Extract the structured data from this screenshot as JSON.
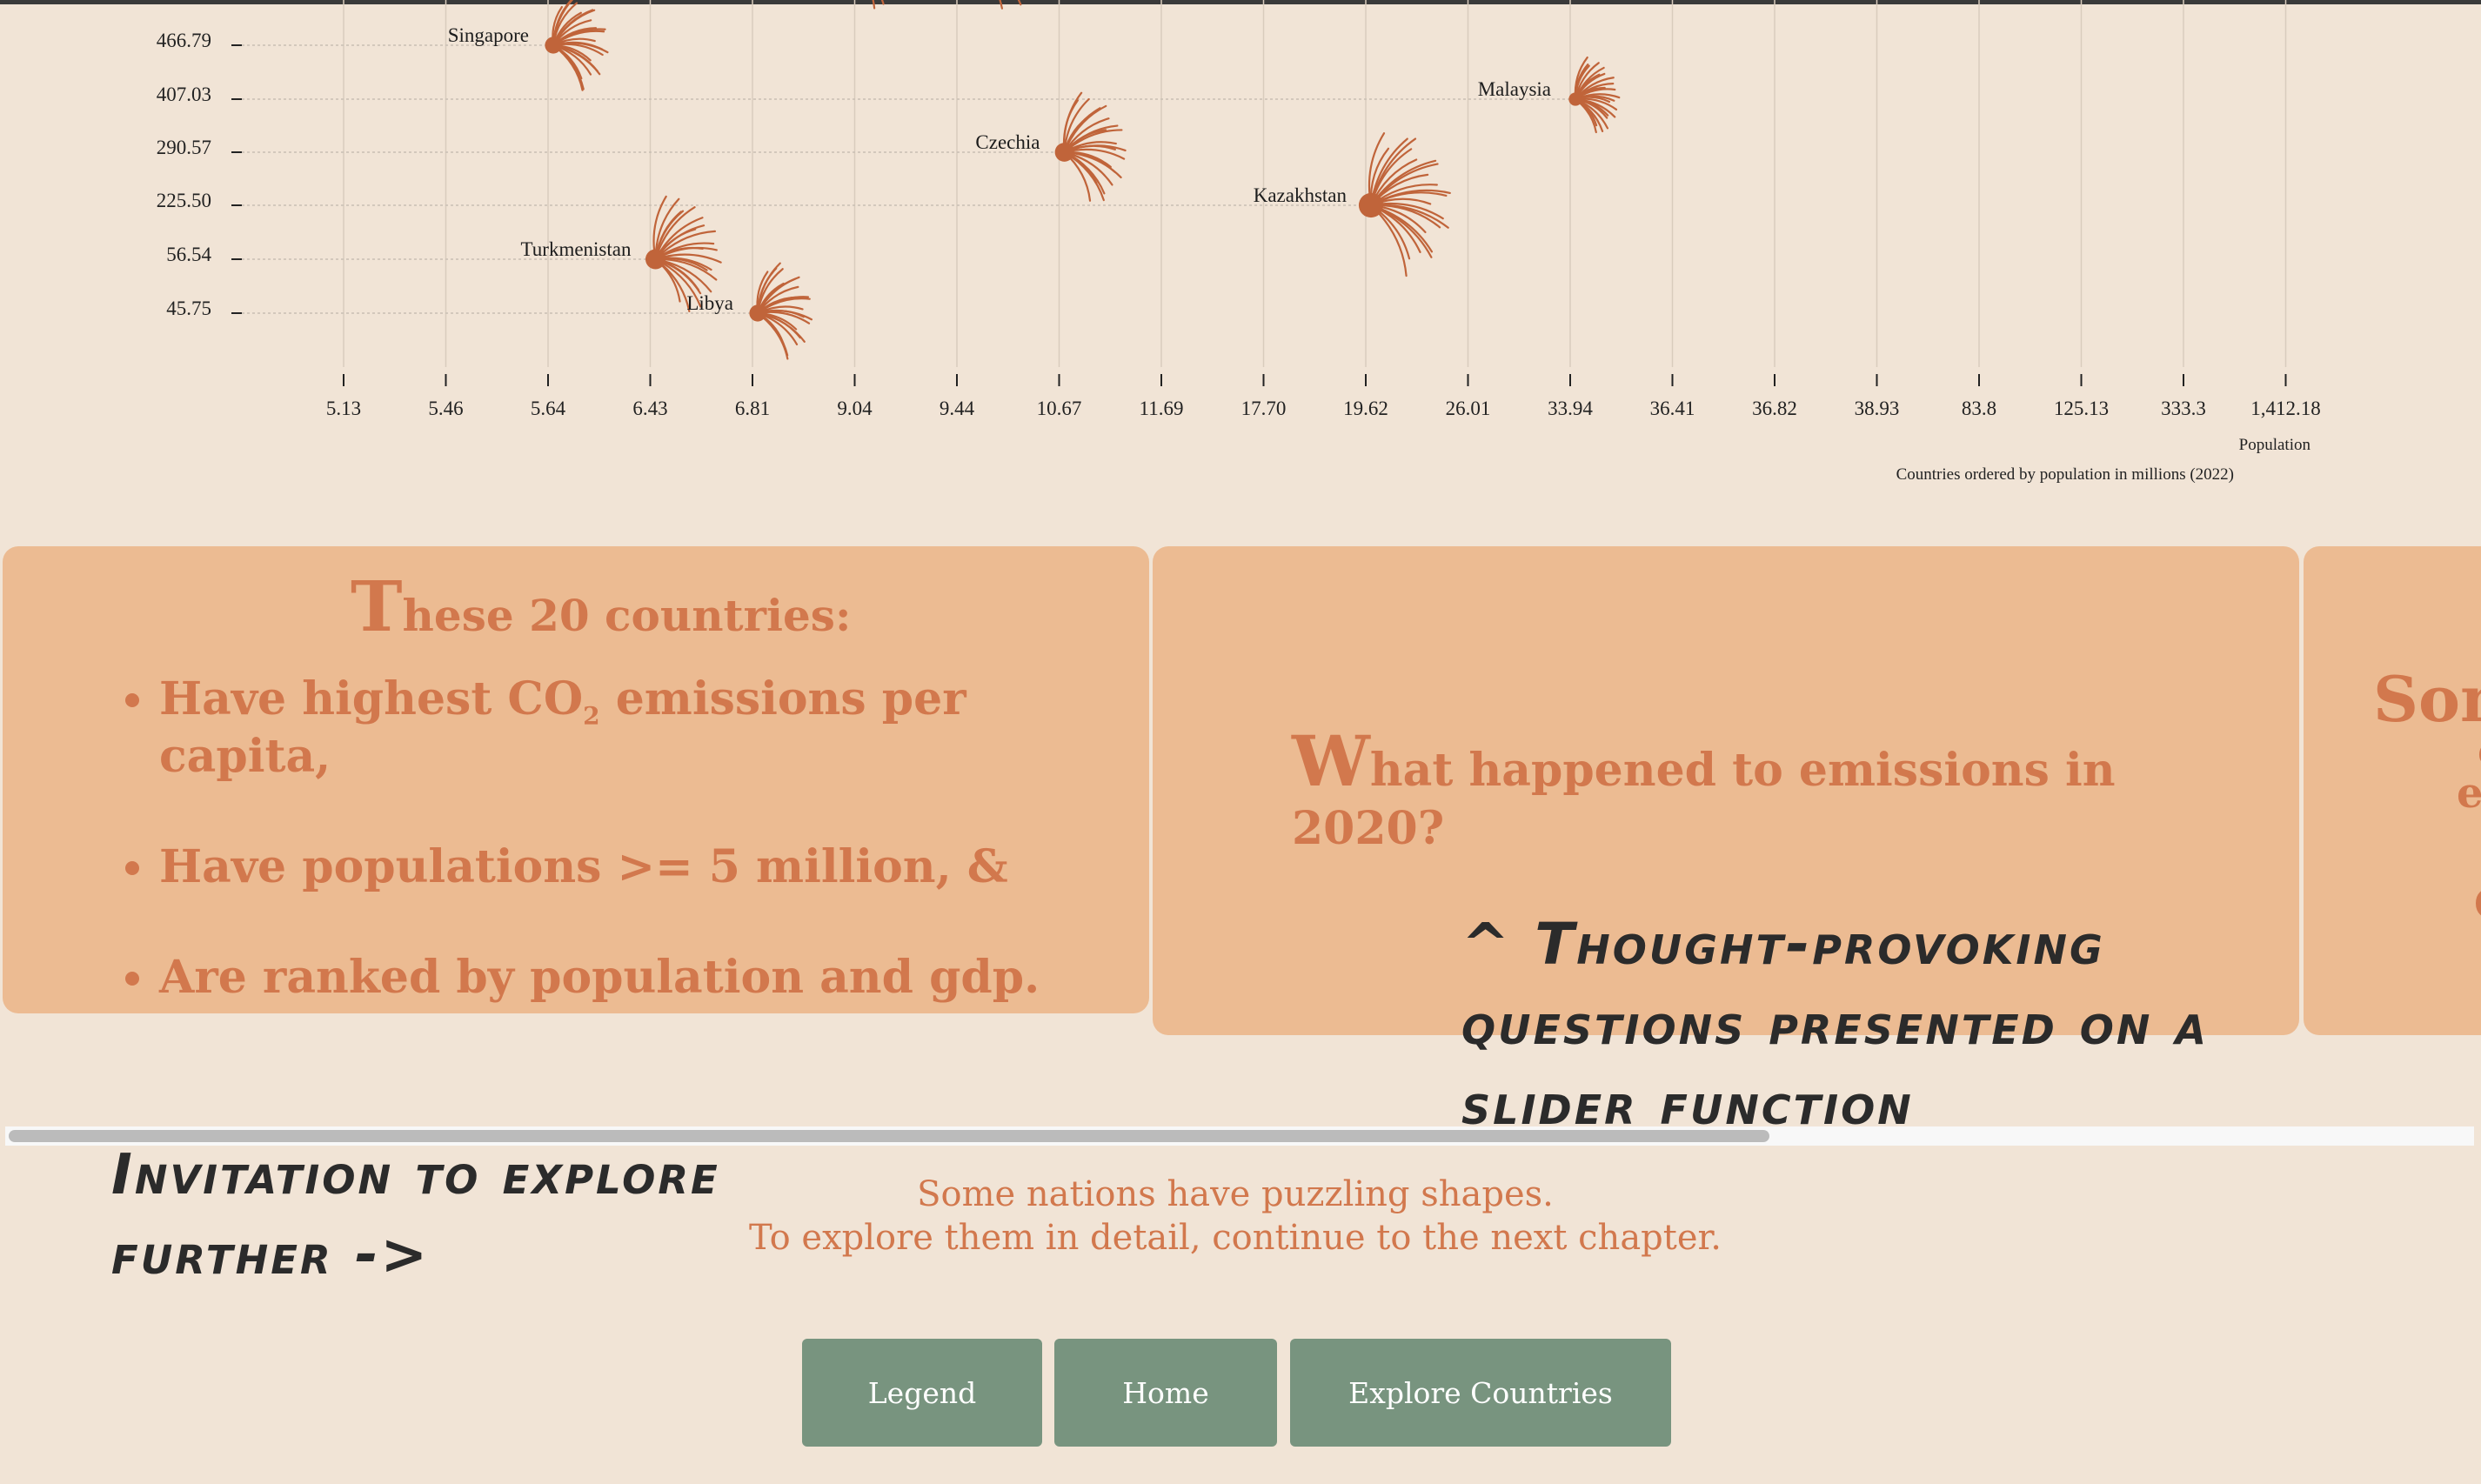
{
  "chart_data": {
    "type": "scatter",
    "x_categories": [
      "5.13",
      "5.46",
      "5.64",
      "6.43",
      "6.81",
      "9.04",
      "9.44",
      "10.67",
      "11.69",
      "17.70",
      "19.62",
      "26.01",
      "33.94",
      "36.41",
      "36.82",
      "38.93",
      "83.8",
      "125.13",
      "333.3",
      "1,412.18"
    ],
    "y_ticks": [
      "466.79",
      "407.03",
      "290.57",
      "225.50",
      "56.54",
      "45.75"
    ],
    "points": [
      {
        "label": "Singapore",
        "x": "5.64",
        "y": "466.79"
      },
      {
        "label": "Malaysia",
        "x": "33.94",
        "y": "407.03"
      },
      {
        "label": "Czechia",
        "x": "10.67",
        "y": "290.57"
      },
      {
        "label": "Kazakhstan",
        "x": "19.62",
        "y": "225.50"
      },
      {
        "label": "Turkmenistan",
        "x": "6.43",
        "y": "56.54"
      },
      {
        "label": "Libya",
        "x": "6.81",
        "y": "45.75"
      }
    ],
    "xlabel": "Population",
    "caption": "Countries ordered by population in millions (2022)",
    "colors": {
      "glyph": "#c0643a"
    }
  },
  "card1": {
    "title_initial": "T",
    "title_rest": "hese 20 countries:",
    "items": [
      {
        "pre": "Have highest CO",
        "sub": "2",
        "post": " emissions per capita,"
      },
      {
        "pre": "Have populations >= 5 million, &",
        "sub": "",
        "post": ""
      },
      {
        "pre": "Are ranked by population and gdp.",
        "sub": "",
        "post": ""
      }
    ]
  },
  "card2": {
    "title_initial": "W",
    "title_rest": "hat happened to emissions in 2020?"
  },
  "card3": {
    "lines": [
      "Som",
      "ca",
      "em",
      "C"
    ]
  },
  "notes": {
    "questions": "^ Thought-provoking questions presented on a slider function",
    "invite": "Invitation to explore further ->"
  },
  "explore": {
    "line1": "Some nations have puzzling shapes.",
    "line2": "To explore them in detail, continue to the next chapter."
  },
  "buttons": {
    "legend": "Legend",
    "home": "Home",
    "explore": "Explore Countries"
  },
  "colors": {
    "background": "#f1e4d6",
    "card": "#ecbb92",
    "accent_text": "#d2784d",
    "button": "#78947f"
  }
}
